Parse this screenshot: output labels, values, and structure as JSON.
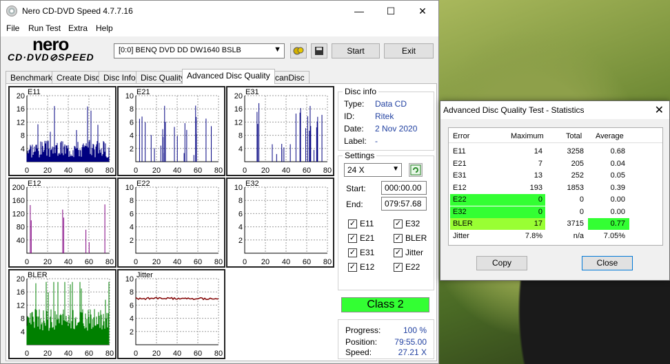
{
  "window": {
    "title": "Nero CD-DVD Speed 4.7.7.16",
    "minimize": "—",
    "maximize": "☐",
    "close": "✕"
  },
  "menu": [
    "File",
    "Run Test",
    "Extra",
    "Help"
  ],
  "logo": {
    "line1": "nero",
    "line2": "CD·DVD⊘SPEED"
  },
  "toolbar": {
    "drive": "[0:0]   BENQ DVD DD DW1640 BSLB",
    "start": "Start",
    "exit": "Exit"
  },
  "tabs": [
    "Benchmark",
    "Create Disc",
    "Disc Info",
    "Disc Quality",
    "Advanced Disc Quality",
    "ScanDisc"
  ],
  "active_tab": "Advanced Disc Quality",
  "disc_info": {
    "title": "Disc info",
    "type_label": "Type:",
    "type": "Data CD",
    "id_label": "ID:",
    "id": "Ritek",
    "date_label": "Date:",
    "date": "2 Nov 2020",
    "label_label": "Label:",
    "label": "-"
  },
  "settings": {
    "title": "Settings",
    "speed": "24 X",
    "start_label": "Start:",
    "start": "000:00.00",
    "end_label": "End:",
    "end": "079:57.68",
    "checks": [
      {
        "name": "E11",
        "checked": true
      },
      {
        "name": "E32",
        "checked": true
      },
      {
        "name": "E21",
        "checked": true
      },
      {
        "name": "BLER",
        "checked": true
      },
      {
        "name": "E31",
        "checked": true
      },
      {
        "name": "Jitter",
        "checked": true
      },
      {
        "name": "E12",
        "checked": true
      },
      {
        "name": "E22",
        "checked": true
      }
    ]
  },
  "class_badge": "Class 2",
  "progress": {
    "progress_label": "Progress:",
    "progress": "100 %",
    "position_label": "Position:",
    "position": "79:55.00",
    "speed_label": "Speed:",
    "speed": "27.21 X"
  },
  "charts": [
    {
      "name": "E11",
      "yticks": [
        "20",
        "16",
        "12",
        "8",
        "4"
      ],
      "color": "#000080"
    },
    {
      "name": "E21",
      "yticks": [
        "10",
        "8",
        "6",
        "4",
        "2"
      ],
      "color": "#000080"
    },
    {
      "name": "E31",
      "yticks": [
        "20",
        "16",
        "12",
        "8",
        "4"
      ],
      "color": "#000080"
    },
    {
      "name": "E12",
      "yticks": [
        "200",
        "160",
        "120",
        "80",
        "40"
      ],
      "color": "#800080"
    },
    {
      "name": "E22",
      "yticks": [
        "10",
        "8",
        "6",
        "4",
        "2"
      ],
      "color": "#000080"
    },
    {
      "name": "E32",
      "yticks": [
        "10",
        "8",
        "6",
        "4",
        "2"
      ],
      "color": "#000080"
    },
    {
      "name": "BLER",
      "yticks": [
        "20",
        "16",
        "12",
        "8",
        "4"
      ],
      "color": "#008000"
    },
    {
      "name": "Jitter",
      "yticks": [
        "10",
        "8",
        "6",
        "4",
        "2"
      ],
      "color": "#800000"
    }
  ],
  "xticks": [
    "0",
    "20",
    "40",
    "60",
    "80"
  ],
  "stats": {
    "title": "Advanced Disc Quality Test - Statistics",
    "close": "✕",
    "headers": [
      "Error",
      "Maximum",
      "Total",
      "Average"
    ],
    "rows": [
      {
        "error": "E11",
        "maximum": "14",
        "total": "3258",
        "average": "0.68"
      },
      {
        "error": "E21",
        "maximum": "7",
        "total": "205",
        "average": "0.04"
      },
      {
        "error": "E31",
        "maximum": "13",
        "total": "252",
        "average": "0.05"
      },
      {
        "error": "E12",
        "maximum": "193",
        "total": "1853",
        "average": "0.39"
      },
      {
        "error": "E22",
        "maximum": "0",
        "total": "0",
        "average": "0.00"
      },
      {
        "error": "E32",
        "maximum": "0",
        "total": "0",
        "average": "0.00"
      },
      {
        "error": "BLER",
        "maximum": "17",
        "total": "3715",
        "average": "0.77"
      },
      {
        "error": "Jitter",
        "maximum": "7.8%",
        "total": "n/a",
        "average": "7.05%"
      }
    ],
    "copy": "Copy",
    "close_btn": "Close"
  },
  "colors": {
    "highlight_green": "#33ff33",
    "highlight_lime": "#99ff33"
  }
}
